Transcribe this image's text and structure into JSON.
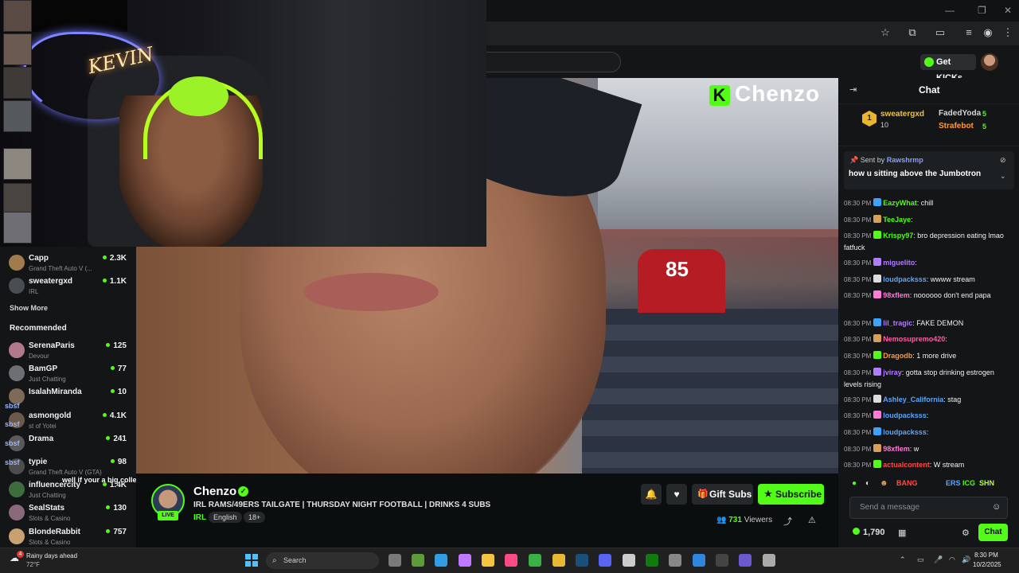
{
  "window": {
    "minimize": "—",
    "maximize": "❐",
    "close": "✕"
  },
  "header": {
    "get_kicks": "Get KICKs"
  },
  "sidebar": {
    "following": [
      {
        "name": "Capp",
        "game": "Grand Theft Auto V (...",
        "viewers": "2.3K",
        "color": "#a07c4c"
      },
      {
        "name": "sweatergxd",
        "game": "IRL",
        "viewers": "1.1K",
        "color": "#4a4d52"
      }
    ],
    "show_more": "Show More",
    "recommended_title": "Recommended",
    "recommended": [
      {
        "name": "SerenaParis",
        "game": "Devour",
        "viewers": "125",
        "color": "#b07a8c"
      },
      {
        "name": "BamGP",
        "game": "Just Chatting",
        "viewers": "77",
        "color": "#6d6f73"
      },
      {
        "name": "IsalahMiranda",
        "game": "",
        "viewers": "10",
        "color": "#7d6a5a"
      },
      {
        "name": "asmongold",
        "game": "st of Yotei",
        "viewers": "4.1K",
        "color": "#6b5a4a"
      },
      {
        "name": "Drama",
        "game": "",
        "viewers": "241",
        "color": "#5a5a5a"
      },
      {
        "name": "typie",
        "game": "Grand Theft Auto V (GTA)",
        "viewers": "98",
        "color": "#4d4d4d"
      },
      {
        "name": "influencercity",
        "game": "Just Chatting",
        "viewers": "1.4K",
        "color": "#3d6d3d"
      },
      {
        "name": "SealStats",
        "game": "Slots & Casino",
        "viewers": "130",
        "color": "#8a6a7a"
      },
      {
        "name": "BlondeRabbit",
        "game": "Slots & Casino",
        "viewers": "757",
        "color": "#c8a072"
      }
    ],
    "overlay_tag": "sbsf",
    "overlay_chat": "well if your a big college"
  },
  "video": {
    "watermark": "Chenzo",
    "watermark_k": "K",
    "jersey": "85"
  },
  "stream": {
    "streamer": "Chenzo",
    "live": "LIVE",
    "title": "IRL RAMS/49ERS TAILGATE | THURSDAY NIGHT FOOTBALL | DRINKS 4 SUBS",
    "category": "IRL",
    "tags": [
      "English",
      "18+"
    ],
    "gift_subs": "Gift Subs",
    "subscribe": "Subscribe",
    "viewers_count": "731",
    "viewers_label": "Viewers"
  },
  "chat": {
    "title": "Chat",
    "leaderboard": {
      "top_rank": "1",
      "top_name": "sweatergxd",
      "top_count": "10",
      "second_name": "FadedYoda",
      "second_count": "5",
      "third_name": "Strafebot",
      "third_count": "5"
    },
    "pinned": {
      "sent_by_label": "Sent by",
      "sent_by": "Rawshrmp",
      "message": "how u sitting above the Jumbotron"
    },
    "messages": [
      {
        "time": "08:30 PM",
        "user": "EazyWhat",
        "text": "chill",
        "color": "#53fc18"
      },
      {
        "time": "08:30 PM",
        "user": "TeeJaye",
        "text": "",
        "color": "#53fc18"
      },
      {
        "time": "08:30 PM",
        "user": "Krispy97",
        "text": "bro depression eating lmao fatfuck",
        "color": "#53fc18"
      },
      {
        "time": "08:30 PM",
        "user": "miguelito",
        "text": "",
        "color": "#b27cff"
      },
      {
        "time": "08:30 PM",
        "user": "loudpacksss",
        "text": "wwww stream",
        "color": "#5aa6ff"
      },
      {
        "time": "08:30 PM",
        "user": "98xflem",
        "text": "noooooo don't end papa",
        "color": "#ff7ad9"
      },
      {
        "time": "08:30 PM",
        "user": "lil_tragic",
        "text": "FAKE DEMON",
        "color": "#b27cff"
      },
      {
        "time": "08:30 PM",
        "user": "Nemosupremo420",
        "text": "",
        "color": "#ff5ca8"
      },
      {
        "time": "08:30 PM",
        "user": "Dragodb",
        "text": "1 more drive",
        "color": "#ff9a3c"
      },
      {
        "time": "08:30 PM",
        "user": "jviray",
        "text": "gotta stop drinking estrogen levels rising",
        "color": "#b27cff"
      },
      {
        "time": "08:30 PM",
        "user": "Ashley_California",
        "text": "stag",
        "color": "#5aa6ff"
      },
      {
        "time": "08:30 PM",
        "user": "loudpacksss",
        "text": "",
        "color": "#5aa6ff"
      },
      {
        "time": "08:30 PM",
        "user": "loudpacksss",
        "text": "",
        "color": "#5aa6ff"
      },
      {
        "time": "08:30 PM",
        "user": "98xflem",
        "text": "w",
        "color": "#ff7ad9"
      },
      {
        "time": "08:30 PM",
        "user": "actualcontent",
        "text": "W stream",
        "color": "#ff4a4a"
      }
    ],
    "emotes": [
      "BANG",
      "ERS",
      "ICG",
      "SHN"
    ],
    "input_placeholder": "Send a message",
    "kicks_balance": "1,790",
    "send": "Chat"
  },
  "taskbar": {
    "weather_badge": "4",
    "weather_title": "Rainy days ahead",
    "weather_temp": "72°F",
    "search": "Search",
    "time": "8:30 PM",
    "date": "10/2/2025"
  }
}
